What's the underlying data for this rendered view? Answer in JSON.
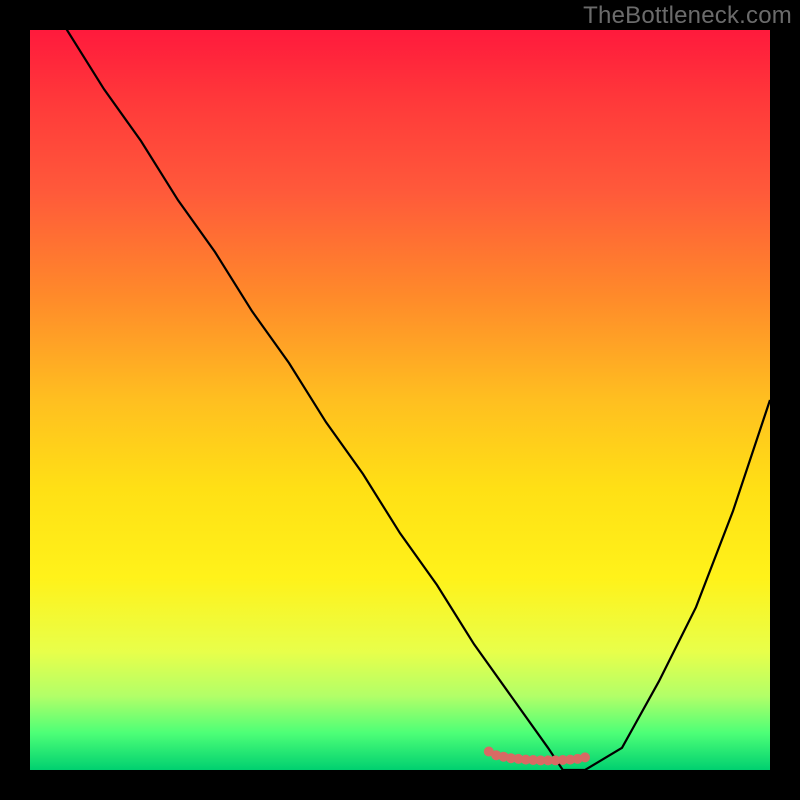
{
  "watermark_text": "TheBottleneck.com",
  "colors": {
    "background": "#000000",
    "curve": "#000000",
    "marker": "#d86a64",
    "gradient_top": "#ff1a3c",
    "gradient_bottom": "#00d070",
    "watermark": "#6b6b6b"
  },
  "chart_data": {
    "type": "line",
    "title": "",
    "xlabel": "",
    "ylabel": "",
    "xlim": [
      0,
      100
    ],
    "ylim": [
      0,
      100
    ],
    "x": [
      0,
      5,
      10,
      15,
      20,
      25,
      30,
      35,
      40,
      45,
      50,
      55,
      60,
      65,
      70,
      72,
      75,
      80,
      85,
      90,
      95,
      100
    ],
    "values": [
      107,
      100,
      92,
      85,
      77,
      70,
      62,
      55,
      47,
      40,
      32,
      25,
      17,
      10,
      3,
      0,
      0,
      3,
      12,
      22,
      35,
      50
    ],
    "note": "V-shaped bottleneck curve; y≈0 indicates optimal match. Values estimated from pixel positions (no axis ticks present).",
    "markers": {
      "x": [
        62,
        63,
        64,
        65,
        66,
        67,
        68,
        69,
        70,
        71,
        72,
        73,
        74,
        75
      ],
      "y": [
        2.5,
        2.0,
        1.8,
        1.6,
        1.5,
        1.4,
        1.35,
        1.3,
        1.3,
        1.3,
        1.35,
        1.4,
        1.5,
        1.7
      ],
      "description": "small salmon-colored dots along bottom of valley"
    }
  }
}
